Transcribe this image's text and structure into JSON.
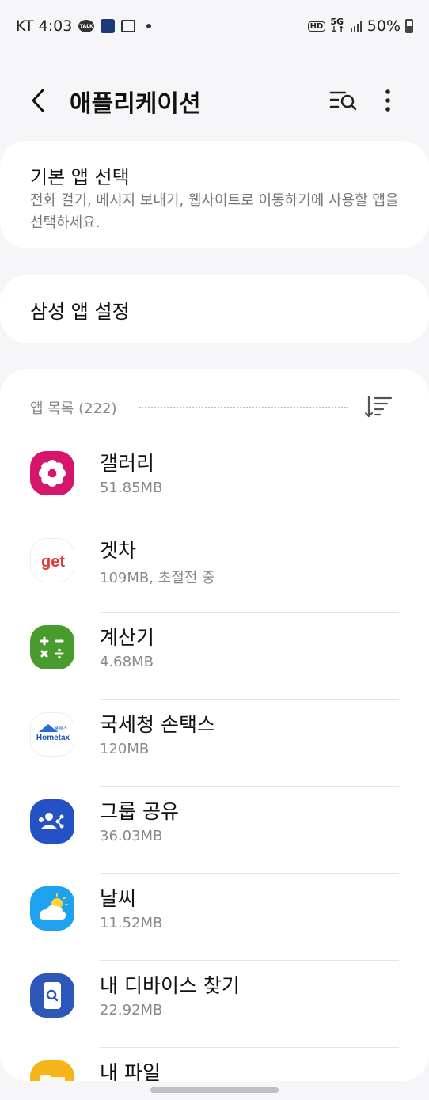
{
  "status_bar": {
    "carrier_time": "KT 4:03",
    "battery": "50%"
  },
  "header": {
    "title": "애플리케이션"
  },
  "default_apps": {
    "title": "기본 앱 선택",
    "subtitle": "전화 걸기, 메시지 보내기, 웹사이트로 이동하기에 사용할 앱을 선택하세요."
  },
  "samsung_settings": {
    "title": "삼성 앱 설정"
  },
  "app_list": {
    "header": "앱 목록 (222)",
    "apps": [
      {
        "name": "갤러리",
        "size": "51.85MB"
      },
      {
        "name": "겟차",
        "size": "109MB, 초절전 중"
      },
      {
        "name": "계산기",
        "size": "4.68MB"
      },
      {
        "name": "국세청 손택스",
        "size": "120MB"
      },
      {
        "name": "그룹 공유",
        "size": "36.03MB"
      },
      {
        "name": "날씨",
        "size": "11.52MB"
      },
      {
        "name": "내 디바이스 찾기",
        "size": "22.92MB"
      },
      {
        "name": "내 파일",
        "size": ""
      }
    ]
  },
  "icon_labels": {
    "getcha": "get",
    "hometax_top": "홈택스",
    "hometax": "Hometax"
  },
  "colors": {
    "gallery": "#d6156c",
    "calculator": "#4a9b2e",
    "group_share": "#2451c4",
    "weather": "#1fa2ee",
    "find_device": "#2d57b8",
    "my_files": "#f5b51a"
  }
}
